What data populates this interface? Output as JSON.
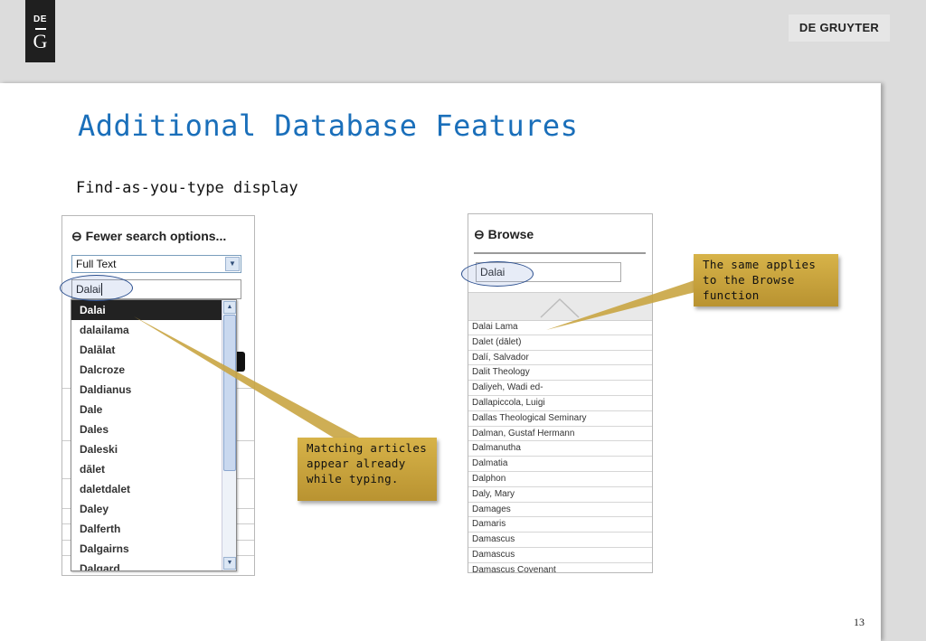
{
  "brand": {
    "logo_top": "DE",
    "logo_bottom": "G",
    "publisher": "DE GRUYTER"
  },
  "slide": {
    "title": "Additional Database Features",
    "subtitle": "Find-as-you-type display",
    "page_number": "13"
  },
  "left_panel": {
    "header": "⊖ Fewer search options...",
    "search_type": "Full Text",
    "search_value": "Dalai",
    "suggestions": [
      "Dalai",
      "dalailama",
      "Dalālat",
      "Dalcroze",
      "Daldianus",
      "Dale",
      "Dales",
      "Daleski",
      "dālet",
      "daletdalet",
      "Daley",
      "Dalferth",
      "Dalgairns",
      "Dalgard"
    ]
  },
  "right_panel": {
    "header": "⊖ Browse",
    "search_value": "Dalai",
    "results": [
      "Dalai Lama",
      "Dalet (dālet)",
      "Dalí, Salvador",
      "Dalit Theology",
      "Daliyeh, Wadi ed-",
      "Dallapiccola, Luigi",
      "Dallas Theological Seminary",
      "Dalman, Gustaf Hermann",
      "Dalmanutha",
      "Dalmatia",
      "Dalphon",
      "Daly, Mary",
      "Damages",
      "Damaris",
      "Damascus",
      "Damascus",
      "Damascus Covenant"
    ]
  },
  "callouts": {
    "typing": "Matching articles appear already while typing.",
    "browse": "The same applies to the Browse function"
  },
  "colors": {
    "title": "#1a6fba",
    "callout": "#c9a542",
    "highlight_ring": "#2b4f8f"
  }
}
